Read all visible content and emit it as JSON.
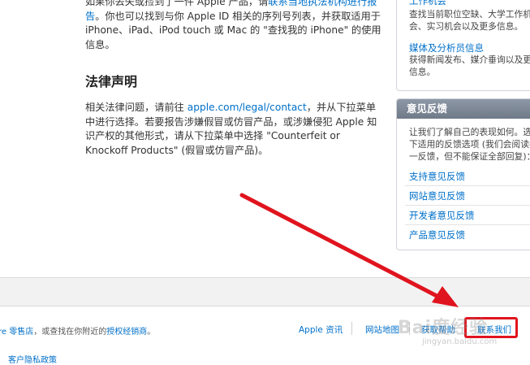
{
  "main": {
    "para1": {
      "pre": "如果你丢失或捡到了一件 Apple 产品，请",
      "link": "联系当地执法机构进行报告",
      "post": "。你也可以找到与你 Apple ID 相关的序列号列表，并获取适用于 iPhone、iPad、iPod touch 或 Mac 的 \"查找我的 iPhone\" 的使用信息。"
    },
    "legal_heading": "法律声明",
    "para2": {
      "pre": "相关法律问题，请前往 ",
      "link": "apple.com/legal/contact",
      "post": "，并从下拉菜单中进行选择。若要报告涉嫌假冒或仿冒产品，或涉嫌侵犯 Apple 知识产权的其他形式，请从下拉菜单中选择 \"Counterfeit or Knockoff Products\" (假冒或仿冒产品)。"
    }
  },
  "sidebar": {
    "jobs_link": "工作机会",
    "jobs_desc": "查找当前职位空缺、大学工作机会、实习机会以及更多信息。",
    "media_link": "媒体及分析员信息",
    "media_desc": "获得新闻发布、媒介垂询以及更多信息。",
    "feedback_title": "意见反馈",
    "feedback_desc": "让我们了解自己的表现如何。选择下适用的反馈选项 (我们会阅读每一反馈，但不能保证全部回复)：",
    "feedback_links": [
      "支持意见反馈",
      "网站意见反馈",
      "开发者意见反馈",
      "产品意见反馈"
    ]
  },
  "footer": {
    "left_text_link1": "re 零售店",
    "left_text_mid": "，或查找在你附近的",
    "left_text_link2": "授权经销商",
    "left_text_end": "。",
    "nav": [
      "Apple 资讯",
      "网站地图",
      "获取帮助",
      "联系我们"
    ],
    "privacy": "客户隐私政策"
  },
  "watermark": {
    "main": "Bai度经验",
    "sub": "jingyan.baidu.com"
  },
  "colors": {
    "link": "#0070c9",
    "highlight": "#e0141e",
    "arrow": "#e0141e"
  }
}
